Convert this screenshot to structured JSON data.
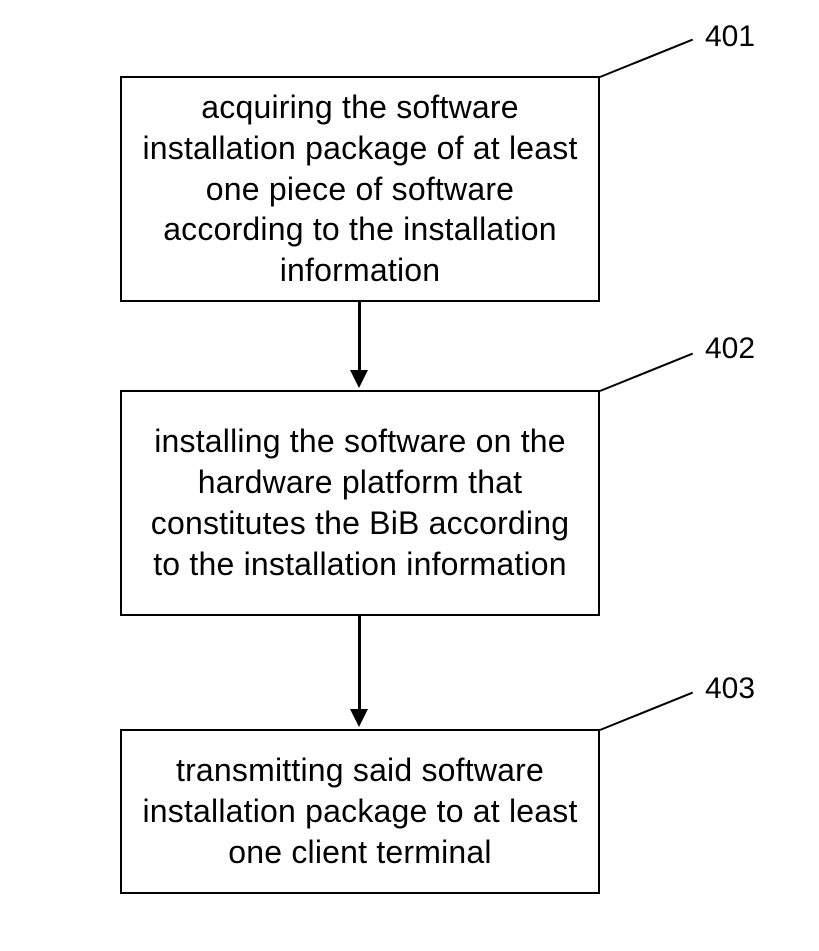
{
  "boxes": {
    "step1": {
      "label": "401",
      "text": "acquiring the software installation package of at least one piece of software according to the installation information"
    },
    "step2": {
      "label": "402",
      "text": "installing the  software on the hardware platform that constitutes the BiB according to the installation information"
    },
    "step3": {
      "label": "403",
      "text": "transmitting said software installation package to at least one client terminal"
    }
  }
}
